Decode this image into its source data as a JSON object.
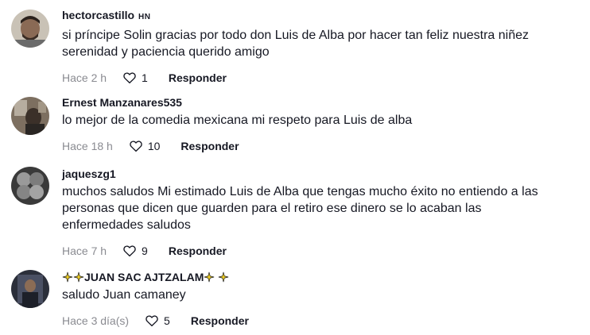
{
  "reply_label": "Responder",
  "colors": {
    "primary_text": "#161823",
    "secondary_text": "#8a8b91",
    "sparkle_icon": "#f5d21e"
  },
  "comments": [
    {
      "username": "hectorcastillo",
      "badge": "HN",
      "text_lines": [
        "si príncipe Solin gracias por todo don Luis de Alba por hacer tan feliz nuestra niñez",
        "serenidad y paciencia querido amigo"
      ],
      "time": "Hace 2 h",
      "likes": "1",
      "avatar": "user-avatar-photo"
    },
    {
      "username": "Ernest Manzanares535",
      "text_lines": [
        "lo mejor de la comedia mexicana mi respeto para Luis de alba"
      ],
      "time": "Hace 18 h",
      "likes": "10",
      "avatar": "user-avatar-photo"
    },
    {
      "username": "jaqueszg1",
      "text_lines": [
        "muchos saludos Mi estimado Luis de Alba que tengas mucho éxito no entiendo a las",
        "personas que dicen que guarden para el retiro ese dinero se lo acaban las",
        "enfermedades saludos"
      ],
      "time": "Hace 7 h",
      "likes": "9",
      "avatar": "user-avatar-photo"
    },
    {
      "username": "JUAN SAC AJTZALAM",
      "text_lines": [
        "saludo Juan camaney"
      ],
      "time": "Hace 3 día(s)",
      "likes": "5",
      "avatar": "user-avatar-photo"
    }
  ]
}
